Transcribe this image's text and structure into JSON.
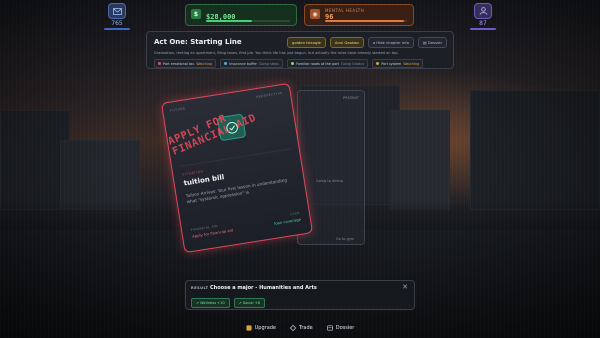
{
  "hud": {
    "left_value": "765",
    "money": {
      "label": "",
      "value": "$28,000",
      "icon": "dollar-icon",
      "fill": 0.55
    },
    "health": {
      "label": "MENTAL HEALTH",
      "value": "96",
      "icon": "brain-icon",
      "fill": 0.96
    },
    "right_value": "87"
  },
  "act": {
    "title": "Act One: Starting Line",
    "description": "Graduation, renting an apartment, filing taxes, first job. You think life has just begun, but actually the rules have already started on top.",
    "chips": [
      "golden triangle",
      "Anxi Gaokao",
      "Hide chapter info",
      "Dossier"
    ],
    "tags": [
      {
        "label": "Port emotional tax",
        "status": "Watching",
        "color": "#e0505e"
      },
      {
        "label": "Insurance buffer",
        "status": "Going steps",
        "color": "#4fb0d0"
      },
      {
        "label": "Familiar roads at the port",
        "status": "Going Gradus",
        "color": "#8fd06a"
      },
      {
        "label": "Port system",
        "status": "Watching",
        "color": "#e0a040"
      }
    ]
  },
  "card": {
    "kicker": "FUTURE",
    "kicker_right": "PERSPECTIVE",
    "stamp": "APPLY FOR FINANCIAL AID",
    "situation_label": "SITUATION",
    "title": "tuition bill",
    "description": "Tuition Arrives: Your first lesson in understanding what \"systemic oppression\" is.",
    "left_option_key": "FINANCIAL AID",
    "left_option": "Apply for financial aid",
    "right_option_key": "LOAN",
    "right_option": "loan coverage"
  },
  "scene_labels": {
    "ghost_top": "PRESENT",
    "ghost_mid": "Going to dining",
    "ghost_bottom": "Go to gym"
  },
  "result": {
    "label": "RESULT",
    "title": "Choose a major - Humanities and Arts",
    "close": "✕",
    "effects": [
      "Wellness +10",
      "Social +6"
    ]
  },
  "nav": {
    "items": [
      {
        "label": "Upgrade",
        "icon": "upgrade-icon",
        "color": "#d9a13c"
      },
      {
        "label": "Trade",
        "icon": "trade-icon",
        "color": "#c9ceda"
      },
      {
        "label": "Dossier",
        "icon": "dossier-icon",
        "color": "#c9ceda"
      }
    ]
  }
}
